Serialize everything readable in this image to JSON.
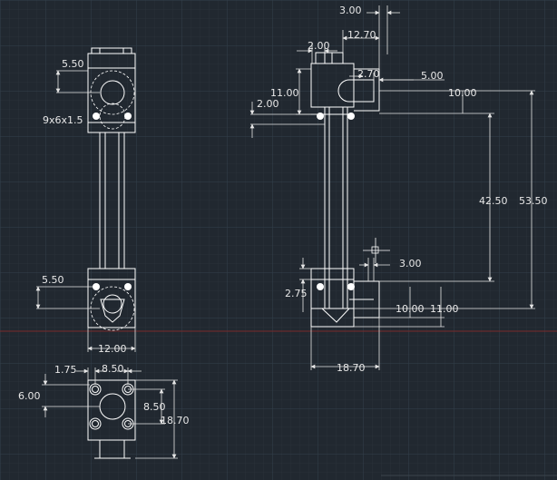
{
  "view_side": {
    "note_thread": "9x6x1.5",
    "dim_top_left": "5.50",
    "dim_bottom_left": "5.50",
    "dim_width": "12.00"
  },
  "view_bottom": {
    "dim_hole_offset": "1.75",
    "dim_hole_spacing_x": "8.50",
    "dim_left_height": "6.00",
    "dim_hole_spacing_y": "8.50",
    "dim_total_height": "18.70"
  },
  "view_front": {
    "dim_top_gap": "3.00",
    "dim_top_width": "12.70",
    "dim_small_width": "2.00",
    "dim_arc_width": "2.70",
    "dim_height_11": "11.00",
    "dim_step_2": "2.00",
    "dim_5": "5.00",
    "dim_10_top": "10.00",
    "dim_42_50": "42.50",
    "dim_53_50": "53.50",
    "dim_3_bottom": "3.00",
    "dim_2_75": "2.75",
    "dim_10_bottom": "10.00",
    "dim_11_bottom": "11.00",
    "dim_base_width": "18.70"
  }
}
